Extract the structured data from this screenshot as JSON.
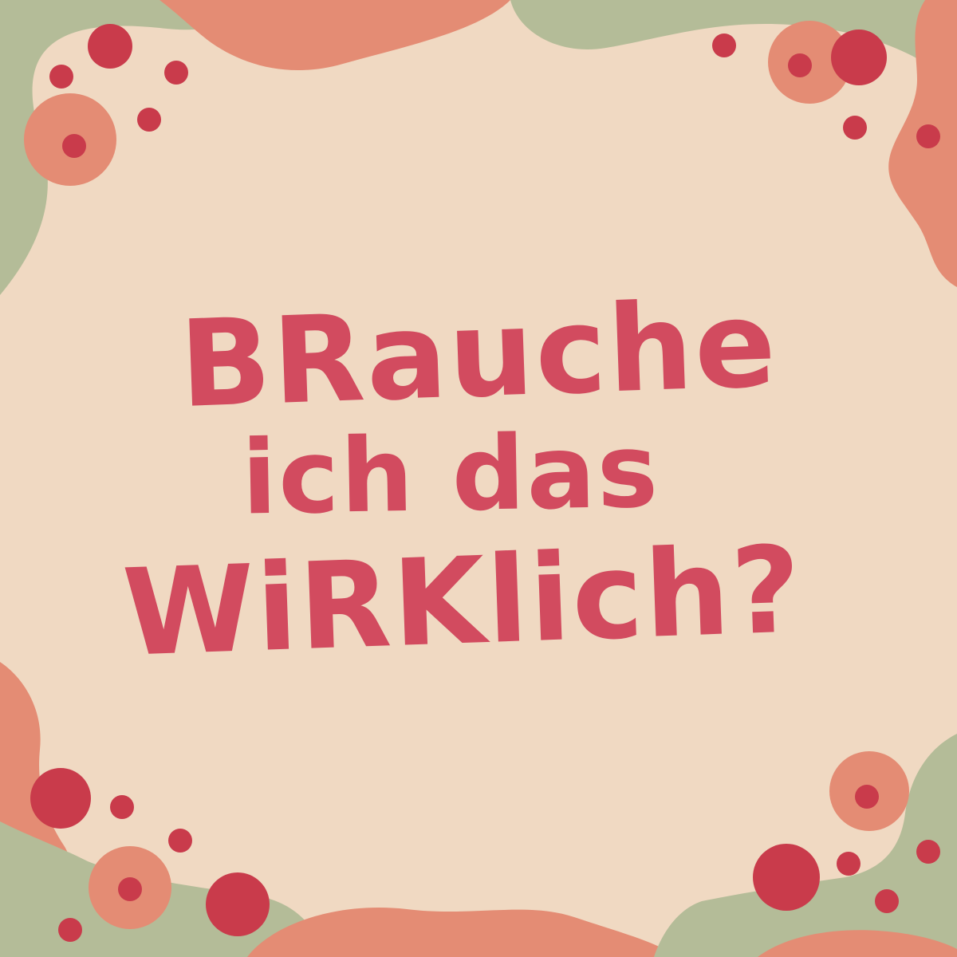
{
  "colors": {
    "background": "#f0d9c2",
    "green": "#b4bc98",
    "salmon": "#e48c74",
    "red": "#c93b4b",
    "text": "#d24b5f"
  },
  "headline": {
    "line1": "BRauche",
    "line2": "ich das",
    "line3": "WiRKlich?"
  }
}
